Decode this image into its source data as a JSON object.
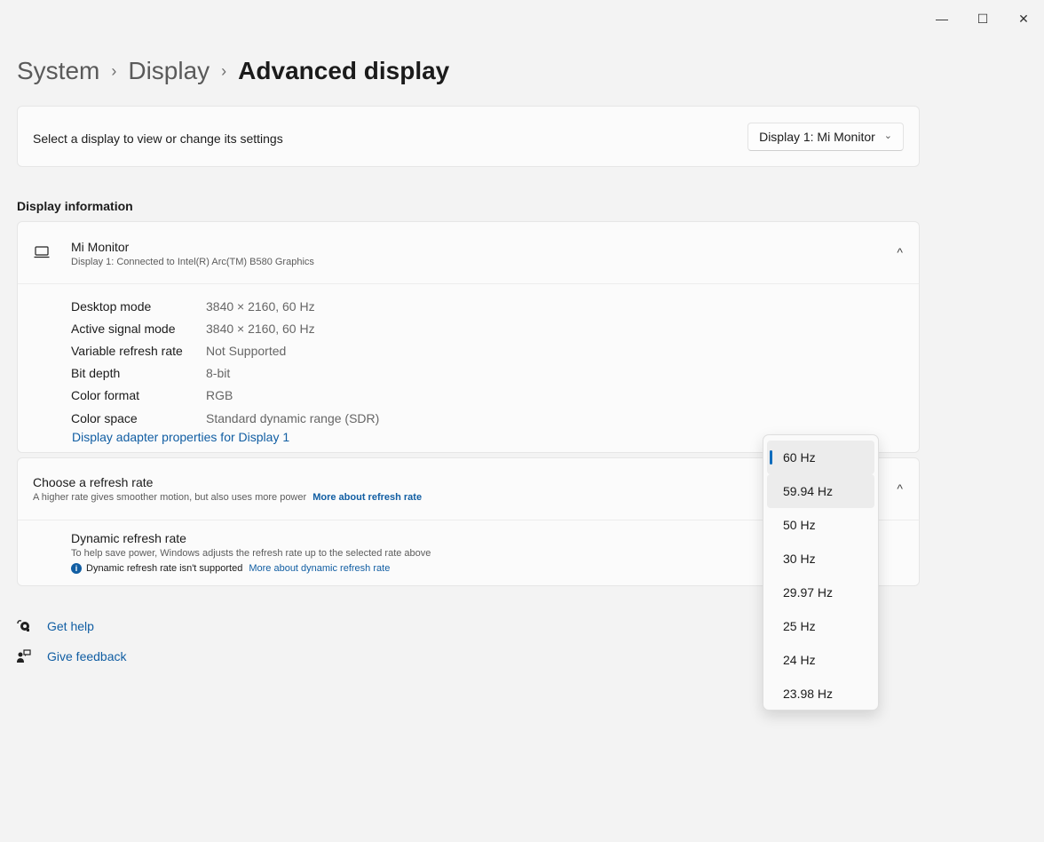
{
  "window": {
    "minimize": "—",
    "maximize": "☐",
    "close": "✕"
  },
  "breadcrumb": {
    "level1": "System",
    "level2": "Display",
    "current": "Advanced display",
    "separator": "›"
  },
  "select_display": {
    "label": "Select a display to view or change its settings",
    "value": "Display 1: Mi Monitor"
  },
  "display_info": {
    "section_title": "Display information",
    "monitor_name": "Mi Monitor",
    "monitor_sub": "Display 1: Connected to Intel(R) Arc(TM) B580 Graphics",
    "rows": [
      {
        "key": "Desktop mode",
        "value": "3840 × 2160, 60 Hz"
      },
      {
        "key": "Active signal mode",
        "value": "3840 × 2160, 60 Hz"
      },
      {
        "key": "Variable refresh rate",
        "value": "Not Supported"
      },
      {
        "key": "Bit depth",
        "value": "8-bit"
      },
      {
        "key": "Color format",
        "value": "RGB"
      },
      {
        "key": "Color space",
        "value": "Standard dynamic range (SDR)"
      }
    ],
    "adapter_link": "Display adapter properties for Display 1"
  },
  "refresh": {
    "title": "Choose a refresh rate",
    "desc": "A higher rate gives smoother motion, but also uses more power",
    "link": "More about refresh rate",
    "dynamic_title": "Dynamic refresh rate",
    "dynamic_desc": "To help save power, Windows adjusts the refresh rate up to the selected rate above",
    "dynamic_note": "Dynamic refresh rate isn't supported",
    "dynamic_link": "More about dynamic refresh rate",
    "info_glyph": "i"
  },
  "help": {
    "get_help": "Get help",
    "feedback": "Give feedback"
  },
  "dropdown": {
    "options": [
      "60 Hz",
      "59.94 Hz",
      "50 Hz",
      "30 Hz",
      "29.97 Hz",
      "25 Hz",
      "24 Hz",
      "23.98 Hz"
    ],
    "selected": "60 Hz",
    "hovered": "59.94 Hz"
  },
  "icons": {
    "chevron_down": "⌄",
    "chevron_up": "^"
  },
  "colors": {
    "accent": "#0f6cbd",
    "link": "#115ea3"
  }
}
